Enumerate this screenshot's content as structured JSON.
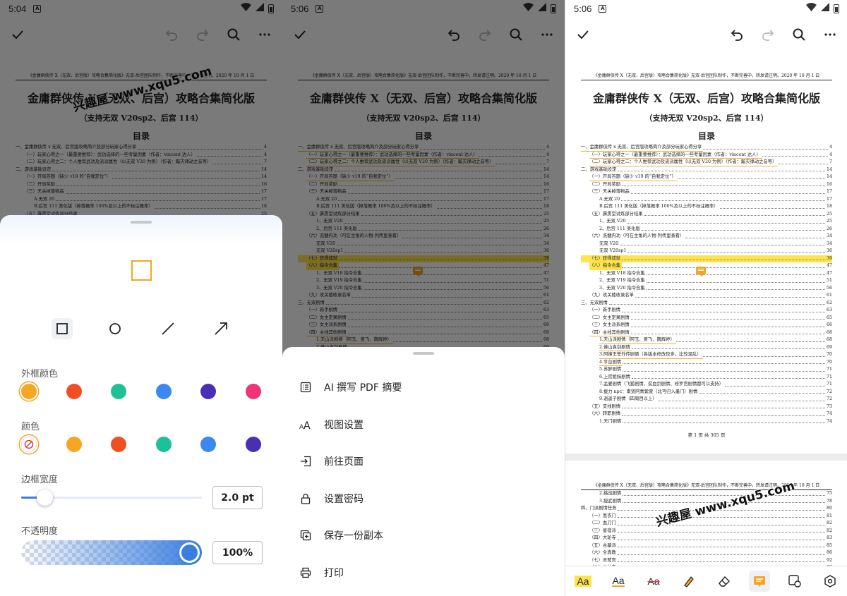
{
  "panels": [
    {
      "status": {
        "time": "5:04"
      }
    },
    {
      "status": {
        "time": "5:06"
      }
    },
    {
      "status": {
        "time": "5:06"
      }
    }
  ],
  "document": {
    "header": "《金庸群侠传 X（无双、后宫版）攻略合集简化版》无双-后宫团队制作，不断完善中，转发请注明。2020 年 10 月 1 日",
    "title": "金庸群侠传 X（无双、后宫）攻略合集简化版",
    "subtitle": "（支持无双 V20sp2、后宫 114）",
    "toc_heading": "目录",
    "toc": [
      {
        "t": "一、金庸群侠传 x 无双、后宫版攻略简介及部分玩家心得分享",
        "n": "4"
      },
      {
        "t": "（一）玩家心得之一（最重要推荐）：武功选择的一些考量因素（作者：vincent 达人）",
        "n": "4"
      },
      {
        "t": "（二）玩家心得之二：个人推荐武功及流派属性（以无双 V20 为例）（作者：黯灭律动之音等）",
        "n": "7"
      },
      {
        "t": "二、游戏基础设定",
        "n": "14"
      },
      {
        "t": "（一）开局答题（缺少 v19 的“自我定位”）",
        "n": "14"
      },
      {
        "t": "（二）开局奖励",
        "n": "16"
      },
      {
        "t": "（三）天关掉落物品",
        "n": "17"
      },
      {
        "t": "A.无双 20",
        "n": "17"
      },
      {
        "t": "B.后宫 111 美化版（掉落概率 100%及以上的不标注概率）",
        "n": "18"
      },
      {
        "t": "（五）霹雳堂试炼部分结果",
        "n": "25"
      },
      {
        "t": "1、无双 V20",
        "n": "25"
      },
      {
        "t": "2、后宫 111 美化版",
        "n": "26"
      },
      {
        "t": "（六）洗髓内功（可在主角的人物-列传里查看）",
        "n": "34"
      },
      {
        "t": "无双 V20",
        "n": "34"
      },
      {
        "t": "无双 V20sp1",
        "n": "36"
      },
      {
        "t": "（七）获得成就",
        "n": "39"
      },
      {
        "t": "（八）指令合集",
        "n": "47"
      },
      {
        "t": "1、无双 V18 指令合集",
        "n": "47"
      },
      {
        "t": "2、无双 V19 指令合集",
        "n": "51"
      },
      {
        "t": "3、无双 V20 指令合集",
        "n": "56"
      },
      {
        "t": "（九）攻关楼收录名单",
        "n": "61"
      },
      {
        "t": "三、无双剧情",
        "n": "62"
      },
      {
        "t": "（一）新手剧情",
        "n": "63"
      },
      {
        "t": "（二）女主定果剧情",
        "n": "65"
      },
      {
        "t": "（三）女主派系剧情",
        "n": "66"
      },
      {
        "t": "（四）主线其他剧情",
        "n": "68"
      },
      {
        "t": "1.天山派剧情（阿玉、贾飞、魏辉婷）",
        "n": "68"
      },
      {
        "t": "2.佛山袁剑剧情",
        "n": "69"
      },
      {
        "t": "3.阿婶王誓外传剧情（各版本修改较多，比较混乱）",
        "n": "70"
      },
      {
        "t": "4.亨台剧情",
        "n": "70"
      },
      {
        "t": "5.苏醉剧情",
        "n": "71"
      },
      {
        "t": "6.上官姐妹剧情",
        "n": "71"
      },
      {
        "t": "7.孟婆剧情（飞狐剧情、贫血剑剧情、修罗宫剧情都可以支持）",
        "n": "71"
      },
      {
        "t": "8.援力 npc：南贤阿青紫萱（北丐归入墨门）剧情",
        "n": "72"
      },
      {
        "t": "9.逍遥子剧情（四周目以上）",
        "n": "72"
      },
      {
        "t": "（五）支线剧情",
        "n": "73"
      },
      {
        "t": "（六）转职剧情",
        "n": "74"
      },
      {
        "t": "1.天门剧情",
        "n": "74"
      }
    ],
    "footer": "第 1 页 共 305 页",
    "page2_toc": [
      {
        "t": "2.挑战剧情",
        "n": "75"
      },
      {
        "t": "3.授武剧情",
        "n": "78"
      },
      {
        "t": "四、门派剧情任务",
        "n": "80"
      },
      {
        "t": "（一）黑衣门",
        "n": "81"
      },
      {
        "t": "（二）血刀门",
        "n": "82"
      },
      {
        "t": "（三）星宿派",
        "n": "82"
      },
      {
        "t": "（四）大轮寺",
        "n": "83"
      },
      {
        "t": "（五）古墓派",
        "n": "85"
      },
      {
        "t": "（六）全真教",
        "n": "86"
      },
      {
        "t": "（七）灵鹫宫",
        "n": "92"
      },
      {
        "t": "（八）少林寺",
        "n": "93"
      }
    ]
  },
  "watermark": "兴趣屋 www.xqu5.com",
  "shape_sheet": {
    "shapes": [
      "rectangle-icon",
      "circle-icon",
      "line-icon",
      "arrow-icon"
    ],
    "border_color_label": "外框颜色",
    "border_colors": [
      "#f5a623",
      "#f04e23",
      "#1dc196",
      "#3d88f0",
      "#4a2fb4",
      "#f0347a"
    ],
    "fill_color_label": "颜色",
    "fill_colors": [
      "none",
      "#f5a623",
      "#f04e23",
      "#1dc196",
      "#3d88f0",
      "#4a2fb4"
    ],
    "border_width_label": "边框宽度",
    "border_width_value": "2.0 pt",
    "border_width_fraction": 0.13,
    "opacity_label": "不透明度",
    "opacity_value": "100%",
    "opacity_fraction": 1.0
  },
  "menu_sheet": {
    "items": [
      {
        "label": "AI 撰写 PDF 摘要",
        "icon": "ai-summary-icon"
      },
      {
        "label": "视图设置",
        "icon": "text-size-icon"
      },
      {
        "label": "前往页面",
        "icon": "goto-page-icon"
      },
      {
        "label": "设置密码",
        "icon": "lock-icon"
      },
      {
        "label": "保存一份副本",
        "icon": "save-copy-icon"
      },
      {
        "label": "打印",
        "icon": "printer-icon"
      }
    ]
  },
  "bottom_toolbar": {
    "tools": [
      {
        "label": "Aa",
        "icon": "highlight-text-icon"
      },
      {
        "label": "Aa",
        "icon": "underline-text-icon"
      },
      {
        "label": "Aa",
        "icon": "strikethrough-text-icon"
      },
      {
        "label": "",
        "icon": "pen-icon"
      },
      {
        "label": "",
        "icon": "eraser-icon"
      },
      {
        "label": "",
        "icon": "note-icon"
      },
      {
        "label": "",
        "icon": "shape-icon"
      },
      {
        "label": "",
        "icon": "settings-icon"
      }
    ]
  },
  "colors": {
    "accent": "#3a7de0",
    "highlight": "#ffe34d",
    "note": "#f5a623"
  }
}
